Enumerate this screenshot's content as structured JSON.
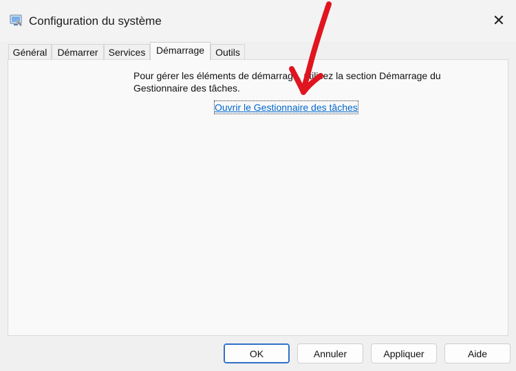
{
  "window": {
    "title": "Configuration du système",
    "close_symbol": "✕"
  },
  "tabs": [
    {
      "label": "Général"
    },
    {
      "label": "Démarrer"
    },
    {
      "label": "Services"
    },
    {
      "label": "Démarrage",
      "active": true
    },
    {
      "label": "Outils"
    }
  ],
  "panel": {
    "message": "Pour gérer les éléments de démarrage, utilisez la section Démarrage du Gestionnaire des tâches.",
    "link_label": "Ouvrir le Gestionnaire des tâches"
  },
  "buttons": {
    "ok": "OK",
    "cancel": "Annuler",
    "apply": "Appliquer",
    "help": "Aide"
  },
  "colors": {
    "link": "#0066cc",
    "annotation_arrow": "#e0151f",
    "primary_border": "#2f6fc8"
  },
  "icons": {
    "app": "system-configuration-icon",
    "close": "close-icon",
    "annotation": "red-arrow-annotation"
  }
}
